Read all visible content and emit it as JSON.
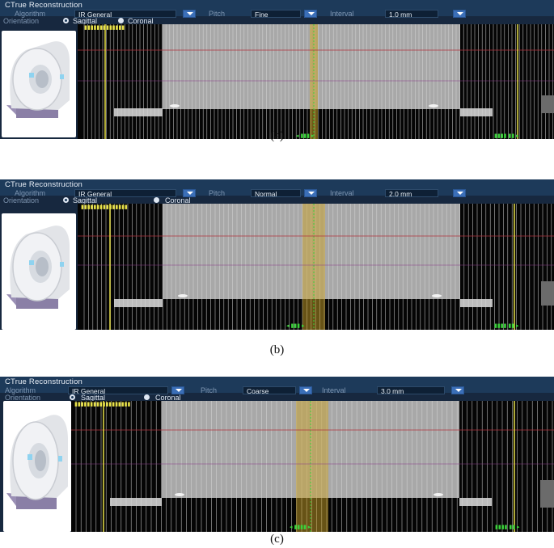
{
  "panels": [
    {
      "title": "CTrue Reconstruction",
      "algorithm_label": "Algorithm",
      "algorithm_value": "IR General",
      "pitch_label": "Pitch",
      "pitch_value": "Fine",
      "interval_label": "Interval",
      "interval_value": "1.0 mm",
      "orientation_label": "Orientation",
      "orientation_options": [
        "Sagittal",
        "Coronal"
      ],
      "orientation_selected": "Sagittal",
      "caption": "(a)"
    },
    {
      "title": "CTrue Reconstruction",
      "algorithm_label": "Algorithm",
      "algorithm_value": "IR General",
      "pitch_label": "Pitch",
      "pitch_value": "Normal",
      "interval_label": "Interval",
      "interval_value": "2.0 mm",
      "orientation_label": "Orientation",
      "orientation_options": [
        "Sagittal",
        "Coronal"
      ],
      "orientation_selected": "Sagittal",
      "caption": "(b)"
    },
    {
      "title": "CTrue Reconstruction",
      "algorithm_label": "Algorithm",
      "algorithm_value": "IR General",
      "pitch_label": "Pitch",
      "pitch_value": "Coarse",
      "interval_label": "Interval",
      "interval_value": "3.0 mm",
      "orientation_label": "Orientation",
      "orientation_options": [
        "Sagittal",
        "Coronal"
      ],
      "orientation_selected": "Sagittal",
      "caption": "(c)"
    }
  ],
  "colors": {
    "panel_bg": "#17283f",
    "header_bg": "#1d3a5a",
    "dropdown_accent": "#3b6fb8",
    "slice_lines": "#d8d8d8",
    "boundary_line": "#e8e24a",
    "selection_band": "#c9a227",
    "marker_green": "#3bd23b",
    "guide_red": "#b0323c"
  },
  "icons": {
    "scanner": "ct-gantry-icon",
    "dropdown": "chevron-down-icon"
  }
}
